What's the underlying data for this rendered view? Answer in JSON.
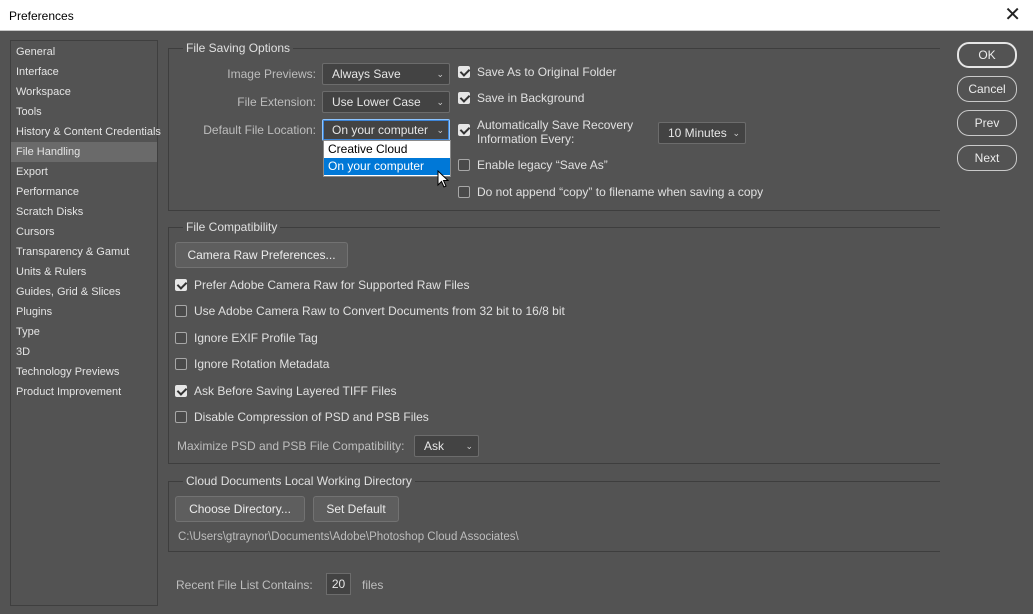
{
  "window": {
    "title": "Preferences",
    "close_glyph": "✕"
  },
  "sidebar": {
    "items": [
      {
        "label": "General"
      },
      {
        "label": "Interface"
      },
      {
        "label": "Workspace"
      },
      {
        "label": "Tools"
      },
      {
        "label": "History & Content Credentials"
      },
      {
        "label": "File Handling",
        "active": true
      },
      {
        "label": "Export"
      },
      {
        "label": "Performance"
      },
      {
        "label": "Scratch Disks"
      },
      {
        "label": "Cursors"
      },
      {
        "label": "Transparency & Gamut"
      },
      {
        "label": "Units & Rulers"
      },
      {
        "label": "Guides, Grid & Slices"
      },
      {
        "label": "Plugins"
      },
      {
        "label": "Type"
      },
      {
        "label": "3D"
      },
      {
        "label": "Technology Previews"
      },
      {
        "label": "Product Improvement"
      }
    ]
  },
  "file_saving": {
    "section_title": "File Saving Options",
    "image_previews": {
      "label": "Image Previews:",
      "value": "Always Save"
    },
    "file_extension": {
      "label": "File Extension:",
      "value": "Use Lower Case"
    },
    "default_location": {
      "label": "Default File Location:",
      "value": "On your computer",
      "options": [
        "Creative Cloud",
        "On your computer"
      ],
      "highlighted": "On your computer"
    },
    "save_as_original": {
      "label": "Save As to Original Folder",
      "checked": true
    },
    "save_in_background": {
      "label": "Save in Background",
      "checked": true
    },
    "auto_save": {
      "label_line1": "Automatically Save Recovery",
      "label_line2": "Information Every:",
      "checked": true,
      "interval": "10 Minutes"
    },
    "legacy_save_as": {
      "label": "Enable legacy “Save As”",
      "checked": false
    },
    "no_copy": {
      "label": "Do not append “copy” to filename when saving a copy",
      "checked": false
    }
  },
  "file_compat": {
    "section_title": "File Compatibility",
    "camera_raw_button": "Camera Raw Preferences...",
    "options": [
      {
        "label": "Prefer Adobe Camera Raw for Supported Raw Files",
        "checked": true
      },
      {
        "label": "Use Adobe Camera Raw to Convert Documents from 32 bit to 16/8 bit",
        "checked": false
      },
      {
        "label": "Ignore EXIF Profile Tag",
        "checked": false
      },
      {
        "label": "Ignore Rotation Metadata",
        "checked": false
      },
      {
        "label": "Ask Before Saving Layered TIFF Files",
        "checked": true
      },
      {
        "label": "Disable Compression of PSD and PSB Files",
        "checked": false
      }
    ],
    "maximize": {
      "label": "Maximize PSD and PSB File Compatibility:",
      "value": "Ask"
    }
  },
  "cloud_docs": {
    "section_title": "Cloud Documents Local Working Directory",
    "choose_button": "Choose Directory...",
    "default_button": "Set Default",
    "path": "C:\\Users\\gtraynor\\Documents\\Adobe\\Photoshop Cloud Associates\\"
  },
  "recent": {
    "label": "Recent File List Contains:",
    "value": "20",
    "suffix": "files"
  },
  "actions": {
    "ok": "OK",
    "cancel": "Cancel",
    "prev": "Prev",
    "next": "Next"
  },
  "icons": {
    "chevron": "chevron-down-icon",
    "checkmark": "checkmark-icon",
    "cursor": "mouse-pointer-icon"
  },
  "colors": {
    "background": "#535353",
    "selection": "#0078d7",
    "focus": "#8ec5ff"
  }
}
